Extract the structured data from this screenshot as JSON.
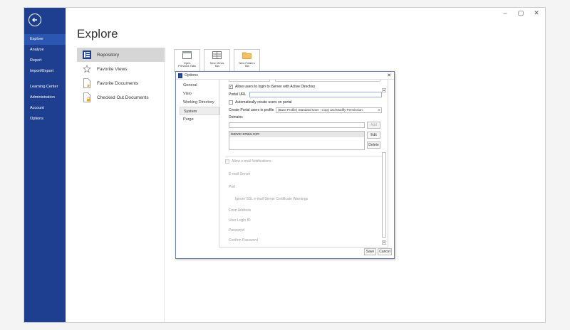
{
  "window": {
    "controls": [
      "–",
      "▢",
      "✕"
    ]
  },
  "sidebar": {
    "items": [
      {
        "label": "Explore"
      },
      {
        "label": "Analyze"
      },
      {
        "label": "Report"
      },
      {
        "label": "Import/Export"
      },
      {
        "label": "Learning Center"
      },
      {
        "label": "Administration"
      },
      {
        "label": "Account"
      },
      {
        "label": "Options"
      }
    ],
    "active": "Explore",
    "color": "#1e3f8f"
  },
  "page": {
    "title": "Explore"
  },
  "places": [
    {
      "label": "Repository",
      "icon": "repository-icon"
    },
    {
      "label": "Favorite Views",
      "icon": "star-icon"
    },
    {
      "label": "Favorite Documents",
      "icon": "document-star-icon"
    },
    {
      "label": "Checked Out Documents",
      "icon": "document-lock-icon"
    }
  ],
  "tiles": [
    {
      "line1": "Open",
      "line2": "Previous Tabs",
      "icon": "window-icon"
    },
    {
      "line1": "New Views",
      "line2": "Tab",
      "icon": "grid-icon"
    },
    {
      "line1": "New Folders",
      "line2": "Tab",
      "icon": "folder-icon"
    }
  ],
  "dialog": {
    "title": "Options",
    "categories": [
      "General",
      "Visio",
      "Working Directory",
      "System",
      "Purge"
    ],
    "active_category": "System",
    "system": {
      "allow_ad_label": "Allow users to login to iServer with Active Directory",
      "allow_ad_checked": true,
      "portal_url_label": "Portal URL",
      "portal_url_value": "",
      "auto_create_label": "Automatically create users on portal",
      "auto_create_checked": false,
      "create_portal_label": "Create Portal users in profile",
      "create_portal_value": "(Base Profile) Standard User - Copy and Modify Permission:",
      "domains_label": "Domains",
      "domain_input": "",
      "add_label": "Add",
      "domains": [
        "iserver-emea.com"
      ],
      "edit_label": "Edit",
      "delete_label": "Delete",
      "email_notify_label": "Allow e-mail Notifications",
      "email_notify_checked": false,
      "email_server_label": "E-mail Server",
      "port_label": "Port",
      "ignore_ssl_label": "Ignore SSL e-mail Server Certificate Warnings",
      "from_address_label": "From Address",
      "user_login_label": "User Login ID",
      "password_label": "Password",
      "confirm_password_label": "Confirm Password"
    },
    "save_label": "Save",
    "cancel_label": "Cancel"
  }
}
